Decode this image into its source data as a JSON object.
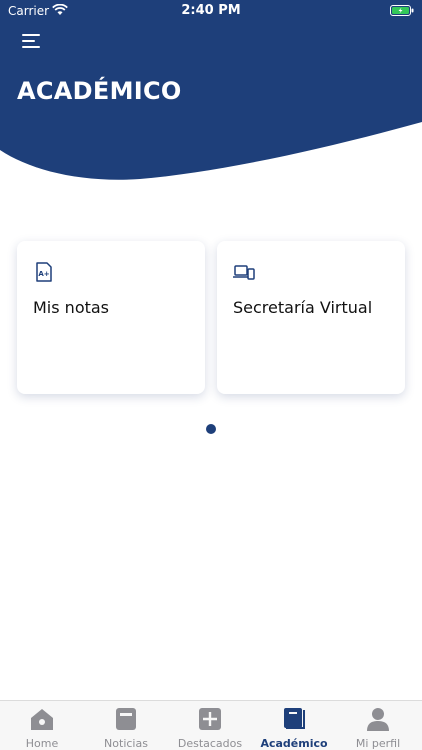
{
  "status_bar": {
    "carrier": "Carrier",
    "time": "2:40 PM"
  },
  "header": {
    "title": "ACADÉMICO"
  },
  "cards": [
    {
      "label": "Mis notas",
      "icon": "grade-document-icon"
    },
    {
      "label": "Secretaría Virtual",
      "icon": "laptop-phone-icon"
    }
  ],
  "tabs": [
    {
      "label": "Home",
      "icon": "home-icon"
    },
    {
      "label": "Noticias",
      "icon": "news-icon"
    },
    {
      "label": "Destacados",
      "icon": "plus-icon"
    },
    {
      "label": "Académico",
      "icon": "book-icon"
    },
    {
      "label": "Mi perfil",
      "icon": "user-icon"
    }
  ],
  "colors": {
    "primary": "#1e3f7a",
    "tab_inactive": "#8e8e93",
    "battery": "#34c759"
  }
}
